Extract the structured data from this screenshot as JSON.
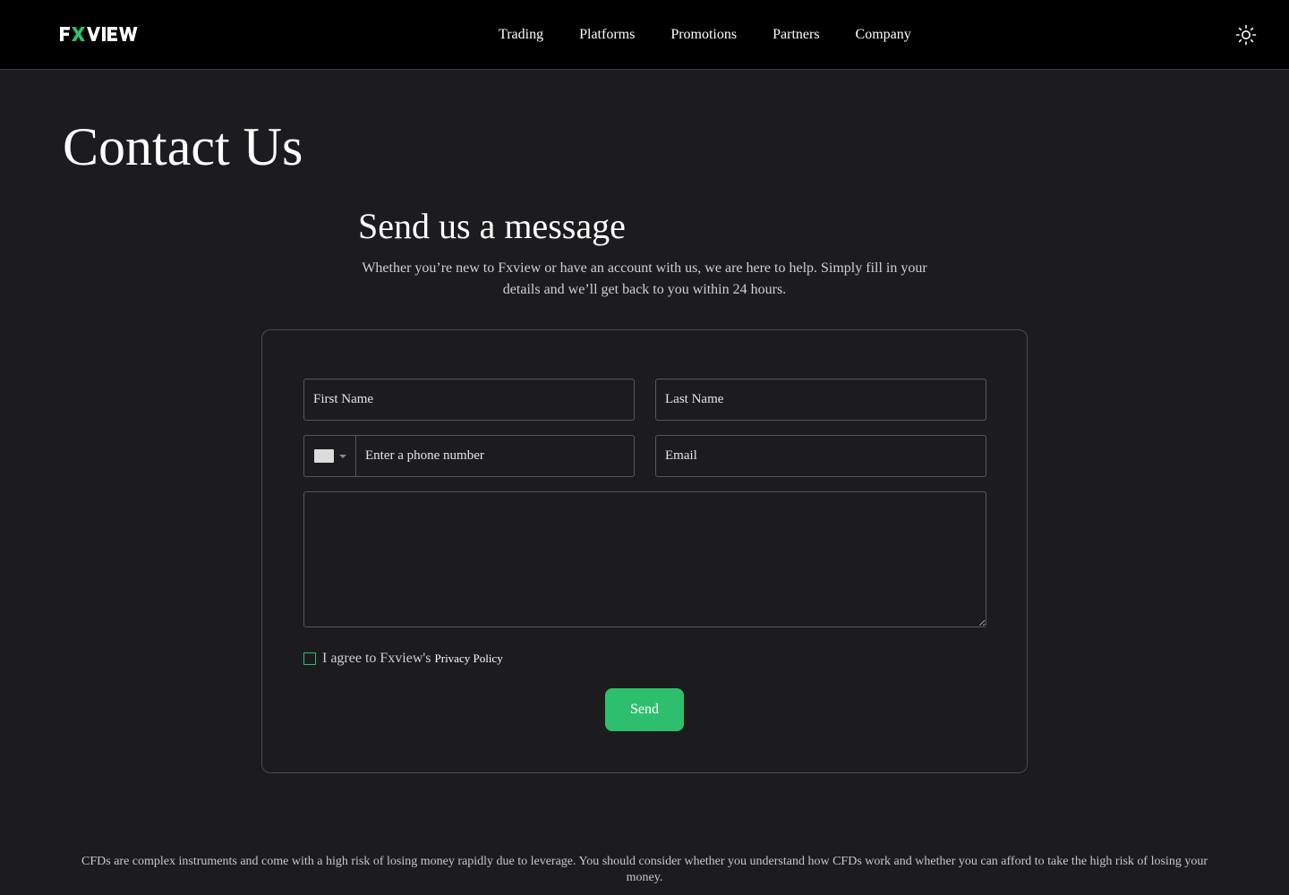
{
  "header": {
    "logo_text": "FXVIEW",
    "nav": [
      "Trading",
      "Platforms",
      "Promotions",
      "Partners",
      "Company"
    ],
    "theme_icon": "sun-icon"
  },
  "main": {
    "title": "Contact Us",
    "section_title": "Send us a message",
    "section_subtitle": "Whether you’re new to Fxview or have an account with us, we are here to help. Simply fill in your details and we’ll get back to you within 24 hours."
  },
  "form": {
    "first_name_placeholder": "First Name",
    "last_name_placeholder": "Last Name",
    "phone_placeholder": "Enter a phone number",
    "email_placeholder": "Email",
    "message_value": "",
    "agree_text": "I agree to Fxview's",
    "privacy_link": "Privacy Policy",
    "send_label": "Send"
  },
  "footer": {
    "disclaimer": "CFDs are complex instruments and come with a high risk of losing money rapidly due to leverage. You should consider whether you understand how CFDs work and whether you can afford to take the high risk of losing your money."
  },
  "colors": {
    "background": "#1c1c1f",
    "header_bg": "#000000",
    "accent": "#2ebf6e",
    "border": "#56565c"
  }
}
